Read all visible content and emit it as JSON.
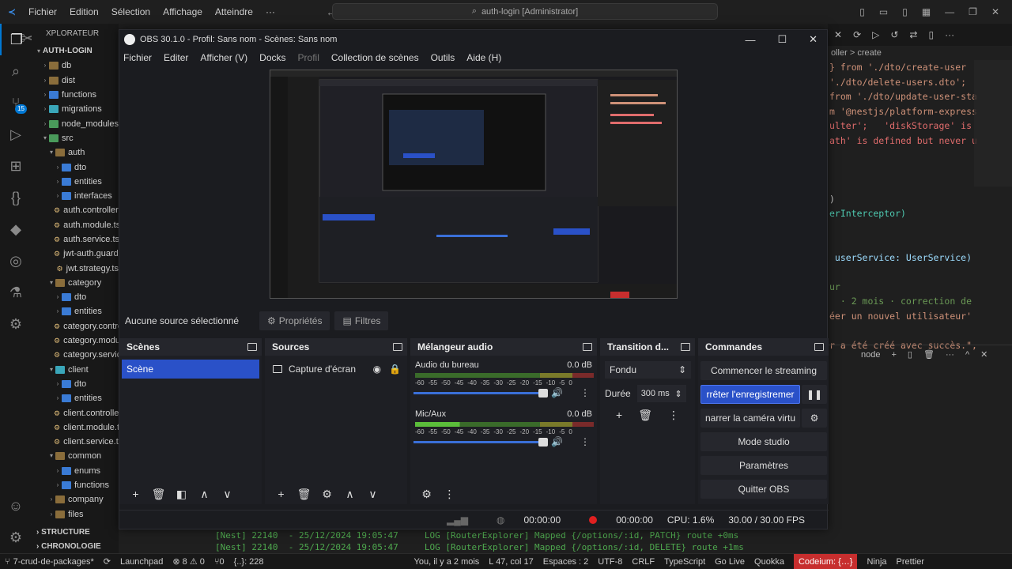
{
  "vscode": {
    "menu": [
      "Fichier",
      "Edition",
      "Sélection",
      "Affichage",
      "Atteindre",
      "···"
    ],
    "search": "auth-login [Administrator]",
    "explorer_title": "XPLORATEUR",
    "project": "AUTH-LOGIN",
    "tree": [
      {
        "label": "db",
        "indent": 1,
        "kind": "fold",
        "color": "brown"
      },
      {
        "label": "dist",
        "indent": 1,
        "kind": "fold",
        "color": "brown"
      },
      {
        "label": "functions",
        "indent": 1,
        "kind": "fold",
        "color": "blue"
      },
      {
        "label": "migrations",
        "indent": 1,
        "kind": "fold",
        "color": "cyan"
      },
      {
        "label": "node_modules",
        "indent": 1,
        "kind": "fold",
        "color": "green"
      },
      {
        "label": "src",
        "indent": 1,
        "kind": "fold",
        "color": "green",
        "open": true
      },
      {
        "label": "auth",
        "indent": 2,
        "kind": "fold",
        "color": "brown",
        "open": true
      },
      {
        "label": "dto",
        "indent": 3,
        "kind": "fold",
        "color": "blue"
      },
      {
        "label": "entities",
        "indent": 3,
        "kind": "fold",
        "color": "blue"
      },
      {
        "label": "interfaces",
        "indent": 3,
        "kind": "fold",
        "color": "blue"
      },
      {
        "label": "auth.controller.ts",
        "indent": 3,
        "kind": "file"
      },
      {
        "label": "auth.module.ts",
        "indent": 3,
        "kind": "file"
      },
      {
        "label": "auth.service.ts",
        "indent": 3,
        "kind": "file"
      },
      {
        "label": "jwt-auth.guard.ts",
        "indent": 3,
        "kind": "file"
      },
      {
        "label": "jwt.strategy.ts",
        "indent": 3,
        "kind": "file"
      },
      {
        "label": "category",
        "indent": 2,
        "kind": "fold",
        "color": "brown",
        "open": true
      },
      {
        "label": "dto",
        "indent": 3,
        "kind": "fold",
        "color": "blue"
      },
      {
        "label": "entities",
        "indent": 3,
        "kind": "fold",
        "color": "blue"
      },
      {
        "label": "category.controller.ts",
        "indent": 3,
        "kind": "file"
      },
      {
        "label": "category.module.ts",
        "indent": 3,
        "kind": "file"
      },
      {
        "label": "category.service.ts",
        "indent": 3,
        "kind": "file"
      },
      {
        "label": "client",
        "indent": 2,
        "kind": "fold",
        "color": "cyan",
        "open": true
      },
      {
        "label": "dto",
        "indent": 3,
        "kind": "fold",
        "color": "blue"
      },
      {
        "label": "entities",
        "indent": 3,
        "kind": "fold",
        "color": "blue"
      },
      {
        "label": "client.controller.ts",
        "indent": 3,
        "kind": "file"
      },
      {
        "label": "client.module.ts",
        "indent": 3,
        "kind": "file"
      },
      {
        "label": "client.service.ts",
        "indent": 3,
        "kind": "file"
      },
      {
        "label": "common",
        "indent": 2,
        "kind": "fold",
        "color": "brown",
        "open": true
      },
      {
        "label": "enums",
        "indent": 3,
        "kind": "fold",
        "color": "blue"
      },
      {
        "label": "functions",
        "indent": 3,
        "kind": "fold",
        "color": "blue"
      },
      {
        "label": "company",
        "indent": 2,
        "kind": "fold",
        "color": "brown"
      },
      {
        "label": "files",
        "indent": 2,
        "kind": "fold",
        "color": "brown"
      }
    ],
    "sections": [
      "STRUCTURE",
      "CHRONOLOGIE"
    ],
    "activity_badge": "15",
    "editor_breadcrumb": "oller > create",
    "code_lines": [
      {
        "text": "} from './dto/create-user",
        "color": "#ce9178"
      },
      {
        "text": "'./dto/delete-users.dto';",
        "color": "#ce9178"
      },
      {
        "text": "from './dto/update-user-sta",
        "color": "#ce9178"
      },
      {
        "text": "m '@nestjs/platform-express",
        "color": "#ce9178"
      },
      {
        "text": "ulter';   'diskStorage' is",
        "color": "#e06c6c"
      },
      {
        "text": "ath' is defined but never u",
        "color": "#e06c6c"
      },
      {
        "text": "",
        "color": "#ccc"
      },
      {
        "text": "",
        "color": "#ccc"
      },
      {
        "text": "",
        "color": "#ccc"
      },
      {
        "text": ")",
        "color": "#ccc"
      },
      {
        "text": "erInterceptor)",
        "color": "#4ec9b0"
      },
      {
        "text": "",
        "color": "#ccc"
      },
      {
        "text": "",
        "color": "#ccc"
      },
      {
        "text": " userService: UserService)",
        "color": "#9cdcfe"
      },
      {
        "text": "",
        "color": "#ccc"
      },
      {
        "text": "ur",
        "color": "#6a9955"
      },
      {
        "text": "  · 2 mois · correction de",
        "color": "#6a9955"
      },
      {
        "text": "éer un nouvel utilisateur'",
        "color": "#ce9178"
      },
      {
        "text": "",
        "color": "#ccc"
      },
      {
        "text": "r a été créé avec succès.\",",
        "color": "#ce9178"
      }
    ],
    "terminal_label": "node",
    "terminal_lines": [
      "[Nest] 22140  - 25/12/2024 19:05:47     LOG [RouterExplorer] Mapped {/options/:id, PATCH} route +0ms",
      "[Nest] 22140  - 25/12/2024 19:05:47     LOG [RouterExplorer] Mapped {/options/:id, DELETE} route +1ms"
    ],
    "statusbar": {
      "branch": "7-crud-de-packages*",
      "launchpad": "Launchpad",
      "problems": "⊗ 8 ⚠ 0",
      "ports": "⑂0",
      "selection": "{..}: 228",
      "blame": "You, il y a 2 mois",
      "position": "L 47, col 17",
      "spaces": "Espaces : 2",
      "encoding": "UTF-8",
      "eol": "CRLF",
      "language": "TypeScript",
      "golive": "Go Live",
      "quokka": "Quokka",
      "codeium": "Codeium: {…}",
      "ninja": "Ninja",
      "prettier": "Prettier"
    }
  },
  "obs": {
    "title": "OBS 30.1.0 - Profil: Sans nom - Scènes: Sans nom",
    "menu": [
      {
        "label": "Fichier",
        "dim": false
      },
      {
        "label": "Editer",
        "dim": false
      },
      {
        "label": "Afficher (V)",
        "dim": false
      },
      {
        "label": "Docks",
        "dim": false
      },
      {
        "label": "Profil",
        "dim": true
      },
      {
        "label": "Collection de scènes",
        "dim": false
      },
      {
        "label": "Outils",
        "dim": false
      },
      {
        "label": "Aide (H)",
        "dim": false
      }
    ],
    "no_source": "Aucune source sélectionné",
    "properties_label": "Propriétés",
    "filters_label": "Filtres",
    "scenes": {
      "title": "Scènes",
      "items": [
        "Scène"
      ]
    },
    "sources": {
      "title": "Sources",
      "items": [
        "Capture d'écran"
      ]
    },
    "mixer": {
      "title": "Mélangeur audio",
      "channels": [
        {
          "name": "Audio du bureau",
          "db": "0.0 dB",
          "level_fraction": 0.0
        },
        {
          "name": "Mic/Aux",
          "db": "0.0 dB",
          "level_fraction": 0.25
        }
      ],
      "ticks": [
        "-60",
        "-55",
        "-50",
        "-45",
        "-40",
        "-35",
        "-30",
        "-25",
        "-20",
        "-15",
        "-10",
        "-5",
        "0"
      ]
    },
    "transition": {
      "title": "Transition d...",
      "type": "Fondu",
      "duration_label": "Durée",
      "duration": "300 ms"
    },
    "controls": {
      "title": "Commandes",
      "start_stream": "Commencer le streaming",
      "stop_record": "rrêter l'enregistremer",
      "virtual_cam": "narrer la caméra virtu",
      "studio_mode": "Mode studio",
      "settings": "Paramètres",
      "quit": "Quitter OBS"
    },
    "status": {
      "stream_time": "00:00:00",
      "rec_time": "00:00:00",
      "cpu": "CPU: 1.6%",
      "fps": "30.00 / 30.00 FPS"
    }
  }
}
